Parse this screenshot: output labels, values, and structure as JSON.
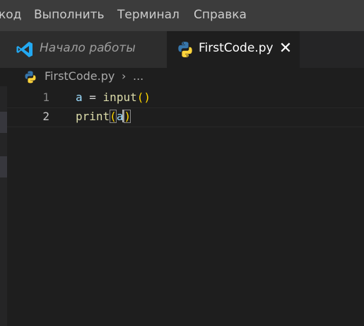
{
  "menu": {
    "items": [
      "код",
      "Выполнить",
      "Терминал",
      "Справка"
    ]
  },
  "tabs": [
    {
      "label": "Начало работы",
      "icon": "vscode-logo-icon",
      "active": false
    },
    {
      "label": "FirstCode.py",
      "icon": "python-file-icon",
      "active": true,
      "close": "✕"
    }
  ],
  "breadcrumb": {
    "file": "FirstCode.py",
    "separator": "›",
    "more": "..."
  },
  "editor": {
    "lines": [
      {
        "number": "1",
        "tokens": [
          {
            "text": "a",
            "kind": "var"
          },
          {
            "text": " = ",
            "kind": "op"
          },
          {
            "text": "input",
            "kind": "fn"
          },
          {
            "text": "()",
            "kind": "paren"
          }
        ]
      },
      {
        "number": "2",
        "tokens": [
          {
            "text": "print",
            "kind": "fn"
          },
          {
            "text": "(",
            "kind": "paren"
          },
          {
            "text": "a",
            "kind": "var"
          },
          {
            "text": ")",
            "kind": "paren"
          }
        ]
      }
    ]
  },
  "colors": {
    "vscode_blue": "#23a9f2",
    "python_blue": "#3776ab",
    "python_yellow": "#ffd43b"
  }
}
